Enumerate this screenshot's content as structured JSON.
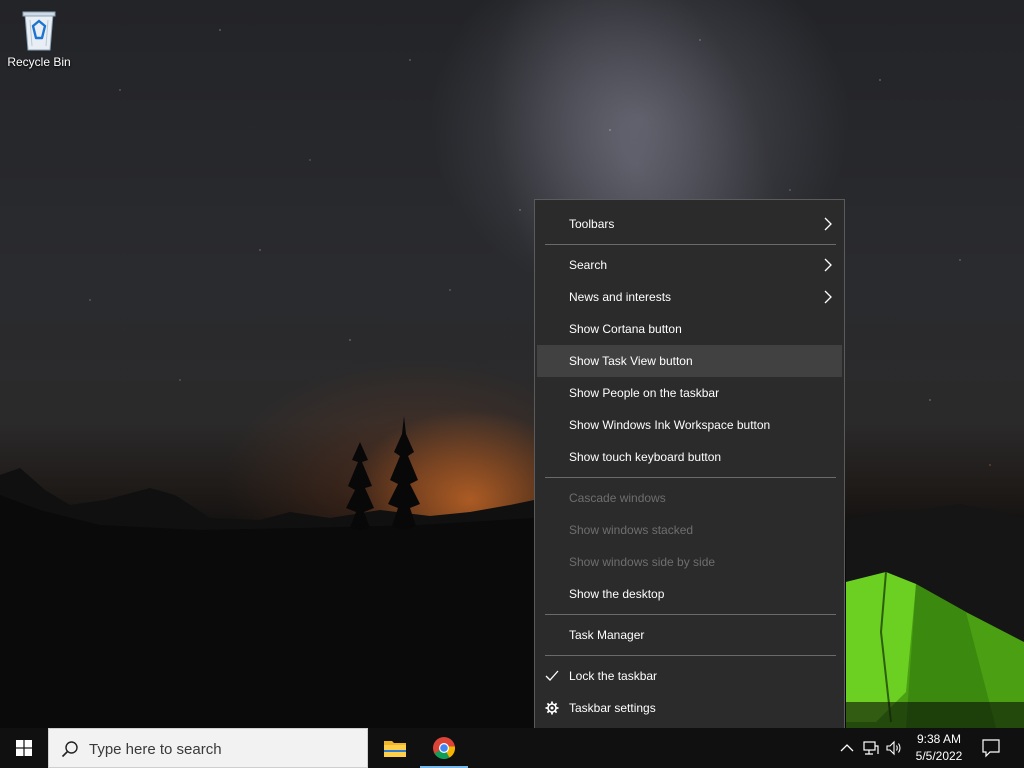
{
  "desktop": {
    "icons": [
      {
        "label": "Recycle Bin",
        "icon": "recycle-bin-icon"
      }
    ]
  },
  "context_menu": {
    "items": [
      {
        "label": "Toolbars",
        "submenu": true,
        "enabled": true
      },
      {
        "label": "Search",
        "submenu": true,
        "enabled": true
      },
      {
        "label": "News and interests",
        "submenu": true,
        "enabled": true
      },
      {
        "label": "Show Cortana button",
        "enabled": true
      },
      {
        "label": "Show Task View button",
        "enabled": true,
        "highlighted": true
      },
      {
        "label": "Show People on the taskbar",
        "enabled": true
      },
      {
        "label": "Show Windows Ink Workspace button",
        "enabled": true
      },
      {
        "label": "Show touch keyboard button",
        "enabled": true
      },
      {
        "label": "Cascade windows",
        "enabled": false
      },
      {
        "label": "Show windows stacked",
        "enabled": false
      },
      {
        "label": "Show windows side by side",
        "enabled": false
      },
      {
        "label": "Show the desktop",
        "enabled": true
      },
      {
        "label": "Task Manager",
        "enabled": true
      },
      {
        "label": "Lock the taskbar",
        "enabled": true,
        "checked": true,
        "icon": "checkmark-icon"
      },
      {
        "label": "Taskbar settings",
        "enabled": true,
        "icon": "gear-icon"
      }
    ]
  },
  "taskbar": {
    "start_icon": "windows-logo-icon",
    "search": {
      "placeholder": "Type here to search",
      "icon": "search-icon"
    },
    "pinned_apps": [
      {
        "name": "File Explorer",
        "icon": "file-explorer-icon"
      },
      {
        "name": "Google Chrome",
        "icon": "chrome-icon",
        "active": true
      }
    ],
    "tray": {
      "icons": [
        "chevron-up-icon",
        "network-icon",
        "volume-icon"
      ],
      "time": "9:38 AM",
      "date": "5/5/2022",
      "notification_icon": "action-center-icon"
    }
  },
  "colors": {
    "menu_background": "#2b2b2b",
    "menu_highlight": "#414141",
    "taskbar_background": "#101010",
    "active_app_indicator": "#76b9ed",
    "tent_green": "#5fbf1f"
  }
}
